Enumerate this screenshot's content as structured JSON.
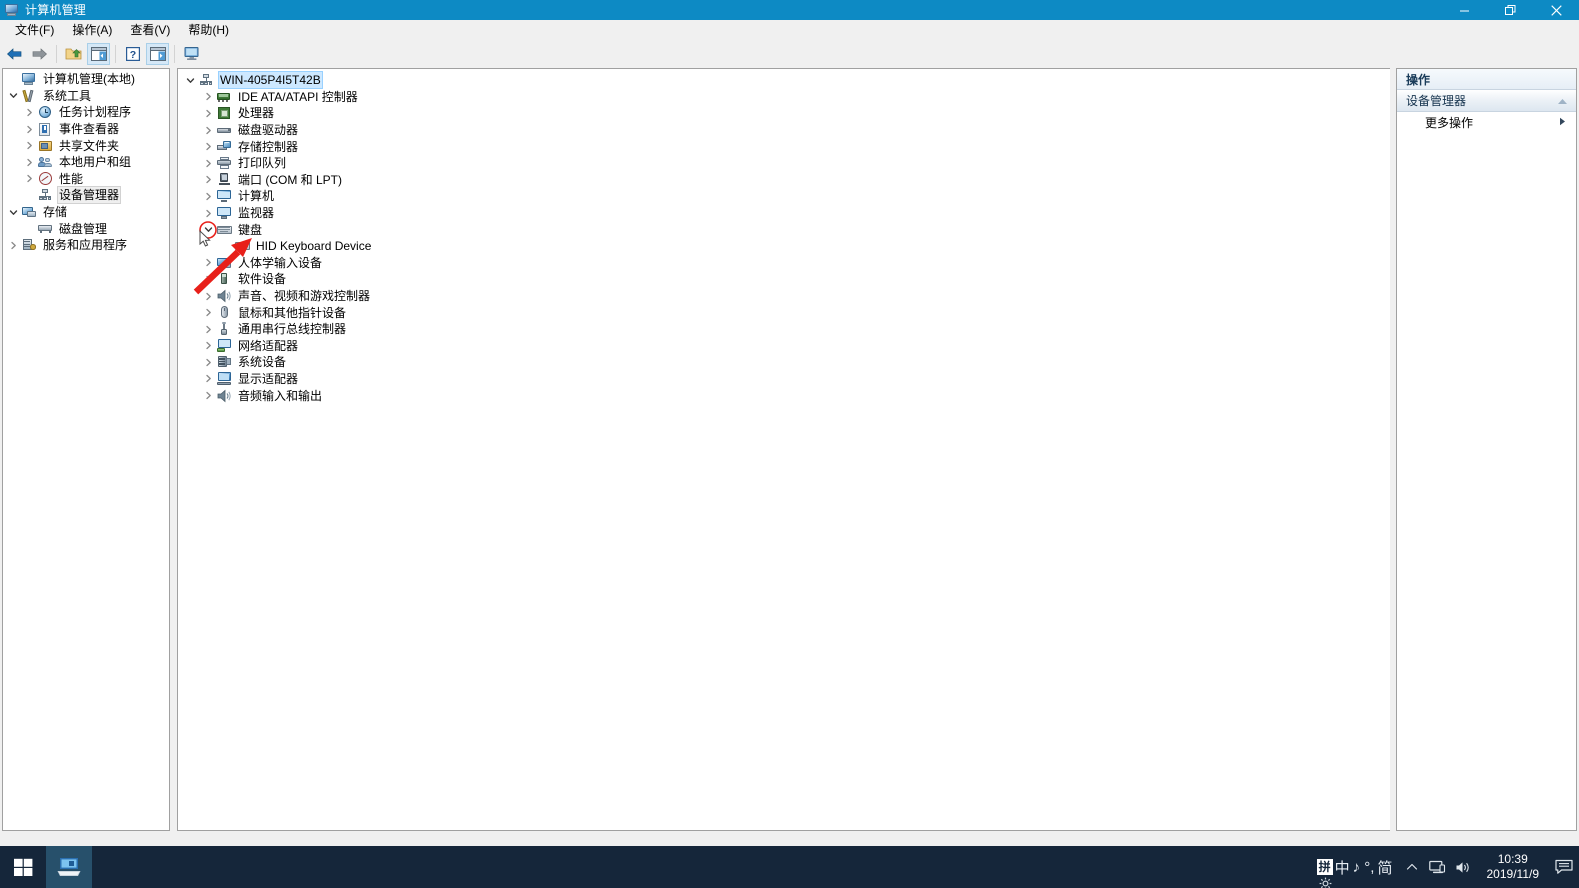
{
  "window": {
    "title": "计算机管理",
    "icon": "computer-management-icon",
    "controls": {
      "minimize": "minimize-icon",
      "restore": "restore-icon",
      "close": "close-icon"
    }
  },
  "menubar": {
    "items": [
      {
        "label": "文件(F)",
        "name": "menu-file"
      },
      {
        "label": "操作(A)",
        "name": "menu-action"
      },
      {
        "label": "查看(V)",
        "name": "menu-view"
      },
      {
        "label": "帮助(H)",
        "name": "menu-help"
      }
    ]
  },
  "toolbar": {
    "buttons": [
      {
        "name": "back-arrow-icon",
        "pressed": false
      },
      {
        "name": "forward-arrow-icon",
        "pressed": false
      },
      {
        "name": "up-folder-icon",
        "pressed": false
      },
      {
        "name": "show-console-tree-icon",
        "pressed": true
      },
      {
        "name": "help-icon",
        "pressed": false
      },
      {
        "name": "properties-icon",
        "pressed": true
      },
      {
        "name": "scan-hardware-icon",
        "pressed": false
      }
    ]
  },
  "console_tree": {
    "root": {
      "label": "计算机管理(本地)",
      "icon": "computer-icon",
      "expanded": true
    },
    "items": [
      {
        "label": "系统工具",
        "icon": "system-tools-icon",
        "indent": 1,
        "expanded": true,
        "has_children": true,
        "selected": false
      },
      {
        "label": "任务计划程序",
        "icon": "task-scheduler-icon",
        "indent": 2,
        "expanded": false,
        "has_children": true,
        "selected": false
      },
      {
        "label": "事件查看器",
        "icon": "event-viewer-icon",
        "indent": 2,
        "expanded": false,
        "has_children": true,
        "selected": false
      },
      {
        "label": "共享文件夹",
        "icon": "shared-folders-icon",
        "indent": 2,
        "expanded": false,
        "has_children": true,
        "selected": false
      },
      {
        "label": "本地用户和组",
        "icon": "local-users-icon",
        "indent": 2,
        "expanded": false,
        "has_children": true,
        "selected": false
      },
      {
        "label": "性能",
        "icon": "performance-icon",
        "indent": 2,
        "expanded": false,
        "has_children": true,
        "selected": false
      },
      {
        "label": "设备管理器",
        "icon": "device-manager-icon",
        "indent": 2,
        "expanded": false,
        "has_children": false,
        "selected": true
      },
      {
        "label": "存储",
        "icon": "storage-icon",
        "indent": 1,
        "expanded": true,
        "has_children": true,
        "selected": false
      },
      {
        "label": "磁盘管理",
        "icon": "disk-management-icon",
        "indent": 2,
        "expanded": false,
        "has_children": false,
        "selected": false
      },
      {
        "label": "服务和应用程序",
        "icon": "services-apps-icon",
        "indent": 1,
        "expanded": false,
        "has_children": true,
        "selected": false
      }
    ]
  },
  "device_tree": {
    "root": {
      "label": "WIN-405P4I5T42B",
      "icon": "computer-node-icon",
      "expanded": true,
      "selected": true
    },
    "nodes": [
      {
        "label": "IDE ATA/ATAPI 控制器",
        "icon": "ide-controller-icon",
        "indent": 1,
        "expanded": false,
        "has_children": true,
        "badge": ""
      },
      {
        "label": "处理器",
        "icon": "processor-icon",
        "indent": 1,
        "expanded": false,
        "has_children": true,
        "badge": ""
      },
      {
        "label": "磁盘驱动器",
        "icon": "disk-drive-icon",
        "indent": 1,
        "expanded": false,
        "has_children": true,
        "badge": ""
      },
      {
        "label": "存储控制器",
        "icon": "storage-controller-icon",
        "indent": 1,
        "expanded": false,
        "has_children": true,
        "badge": ""
      },
      {
        "label": "打印队列",
        "icon": "print-queue-icon",
        "indent": 1,
        "expanded": false,
        "has_children": true,
        "badge": ""
      },
      {
        "label": "端口 (COM 和 LPT)",
        "icon": "ports-icon",
        "indent": 1,
        "expanded": false,
        "has_children": true,
        "badge": ""
      },
      {
        "label": "计算机",
        "icon": "computer-node-icon",
        "indent": 1,
        "expanded": false,
        "has_children": true,
        "badge": ""
      },
      {
        "label": "监视器",
        "icon": "monitor-icon",
        "indent": 1,
        "expanded": false,
        "has_children": true,
        "badge": ""
      },
      {
        "label": "键盘",
        "icon": "keyboard-icon",
        "indent": 1,
        "expanded": true,
        "has_children": true,
        "badge": "collapse-hover"
      },
      {
        "label": "HID Keyboard Device",
        "icon": "hid-keyboard-icon",
        "indent": 2,
        "expanded": false,
        "has_children": false,
        "badge": ""
      },
      {
        "label": "人体学输入设备",
        "icon": "hid-devices-icon",
        "indent": 1,
        "expanded": false,
        "has_children": true,
        "badge": ""
      },
      {
        "label": "软件设备",
        "icon": "software-device-icon",
        "indent": 1,
        "expanded": false,
        "has_children": true,
        "badge": ""
      },
      {
        "label": "声音、视频和游戏控制器",
        "icon": "sound-video-game-icon",
        "indent": 1,
        "expanded": false,
        "has_children": true,
        "badge": ""
      },
      {
        "label": "鼠标和其他指针设备",
        "icon": "mouse-icon",
        "indent": 1,
        "expanded": false,
        "has_children": true,
        "badge": ""
      },
      {
        "label": "通用串行总线控制器",
        "icon": "usb-controller-icon",
        "indent": 1,
        "expanded": false,
        "has_children": true,
        "badge": ""
      },
      {
        "label": "网络适配器",
        "icon": "network-adapter-icon",
        "indent": 1,
        "expanded": false,
        "has_children": true,
        "badge": ""
      },
      {
        "label": "系统设备",
        "icon": "system-device-icon",
        "indent": 1,
        "expanded": false,
        "has_children": true,
        "badge": ""
      },
      {
        "label": "显示适配器",
        "icon": "display-adapter-icon",
        "indent": 1,
        "expanded": false,
        "has_children": true,
        "badge": ""
      },
      {
        "label": "音频输入和输出",
        "icon": "audio-io-icon",
        "indent": 1,
        "expanded": false,
        "has_children": true,
        "badge": ""
      }
    ]
  },
  "actions_pane": {
    "header": "操作",
    "section": {
      "label": "设备管理器",
      "chevron": "chevron-up-icon"
    },
    "items": [
      {
        "label": "更多操作",
        "arrow": "triangle-right-icon"
      }
    ]
  },
  "taskbar": {
    "start": "windows-start-icon",
    "apps": [
      {
        "name": "computer-management-taskbar-icon",
        "active": true
      }
    ],
    "ime": {
      "pin": "拼",
      "mode": "中",
      "symbols": "♪ °,",
      "style": "简",
      "gear": "gear-icon"
    },
    "tray": [
      {
        "name": "show-hidden-icons-chevron",
        "glyph": "^"
      },
      {
        "name": "network-icon"
      },
      {
        "name": "volume-icon"
      }
    ],
    "clock": {
      "time": "10:39",
      "date": "2019/11/9"
    },
    "notifications": "action-center-icon"
  },
  "annotation": {
    "arrow_color": "#e8201a",
    "cursor": "mouse-pointer-icon",
    "target": "HID Keyboard Device"
  },
  "colors": {
    "titlebar": "#0d8ac4",
    "taskbar": "#15263a",
    "chrome": "#f0f0f0",
    "pane_border": "#a0a0a0",
    "selection_active": "#cde8ff",
    "selection_inactive": "#efefef"
  }
}
